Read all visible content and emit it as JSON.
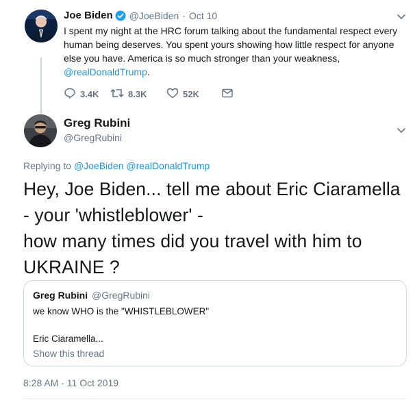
{
  "colors": {
    "link": "#1b95e0",
    "muted": "#657786",
    "text": "#14171a",
    "verified": "#1da1f2",
    "border": "#ccd6dd"
  },
  "first_tweet": {
    "author_name": "Joe Biden",
    "verified": true,
    "handle": "@JoeBiden",
    "separator": "·",
    "date": "Oct 10",
    "text_lines": [
      "I spent my night at the HRC forum talking about the fundamental respect every",
      "human being deserves. You spent yours showing how little respect for anyone",
      "else you have. America is so much stronger than your weakness,"
    ],
    "mention": "@realDonaldTrump",
    "mention_suffix": ".",
    "actions": {
      "replies": "3.4K",
      "retweets": "8.3K",
      "likes": "52K"
    },
    "icons": [
      "reply-icon",
      "retweet-icon",
      "like-icon",
      "dm-icon",
      "chevron-down-icon"
    ]
  },
  "main_tweet": {
    "author_name": "Greg Rubini",
    "handle": "@GregRubini",
    "replying_prefix": "Replying to",
    "replying_to": [
      "@JoeBiden",
      "@realDonaldTrump"
    ],
    "text_lines": [
      "Hey, Joe Biden... tell me about Eric Ciaramella",
      "- your 'whistleblower' -",
      "how many times did you travel with him to",
      "UKRAINE ?"
    ],
    "quoted": {
      "author_name": "Greg Rubini",
      "handle": "@GregRubini",
      "line1": "we know WHO is the \"WHISTLEBLOWER\"",
      "line2": "Eric Ciaramella...",
      "show_thread": "Show this thread"
    },
    "timestamp": "8:28 AM - 11 Oct 2019"
  }
}
